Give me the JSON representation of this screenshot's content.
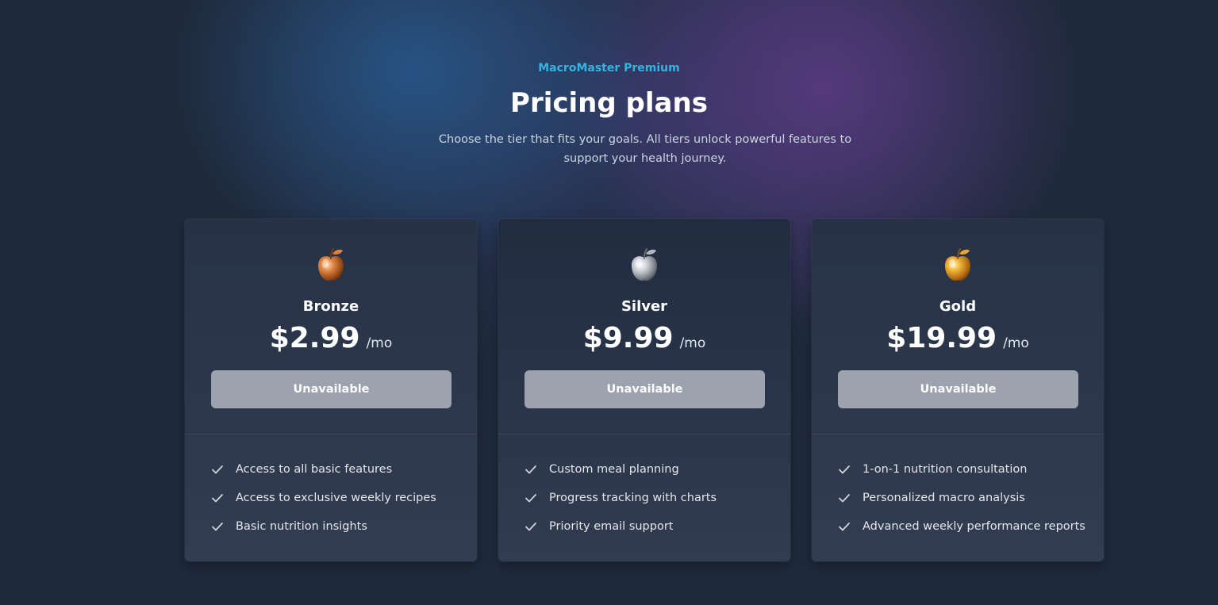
{
  "header": {
    "eyebrow": "MacroMaster Premium",
    "title": "Pricing plans",
    "subtitle": "Choose the tier that fits your goals. All tiers unlock powerful features to support your health journey."
  },
  "plans": [
    {
      "name": "Bronze",
      "icon": "bronze-apple-icon",
      "color": "#c8733a",
      "price": "$2.99",
      "period": "/mo",
      "button_label": "Unavailable",
      "features": [
        "Access to all basic features",
        "Access to exclusive weekly recipes",
        "Basic nutrition insights"
      ]
    },
    {
      "name": "Silver",
      "icon": "silver-apple-icon",
      "color": "#b8bcc2",
      "price": "$9.99",
      "period": "/mo",
      "button_label": "Unavailable",
      "features": [
        "Custom meal planning",
        "Progress tracking with charts",
        "Priority email support"
      ]
    },
    {
      "name": "Gold",
      "icon": "gold-apple-icon",
      "color": "#e0a030",
      "price": "$19.99",
      "period": "/mo",
      "button_label": "Unavailable",
      "features": [
        "1-on-1 nutrition consultation",
        "Personalized macro analysis",
        "Advanced weekly performance reports"
      ]
    }
  ],
  "colors": {
    "accent": "#38b2e0",
    "button_disabled": "#9ca3af",
    "background": "#1f2a3c"
  }
}
